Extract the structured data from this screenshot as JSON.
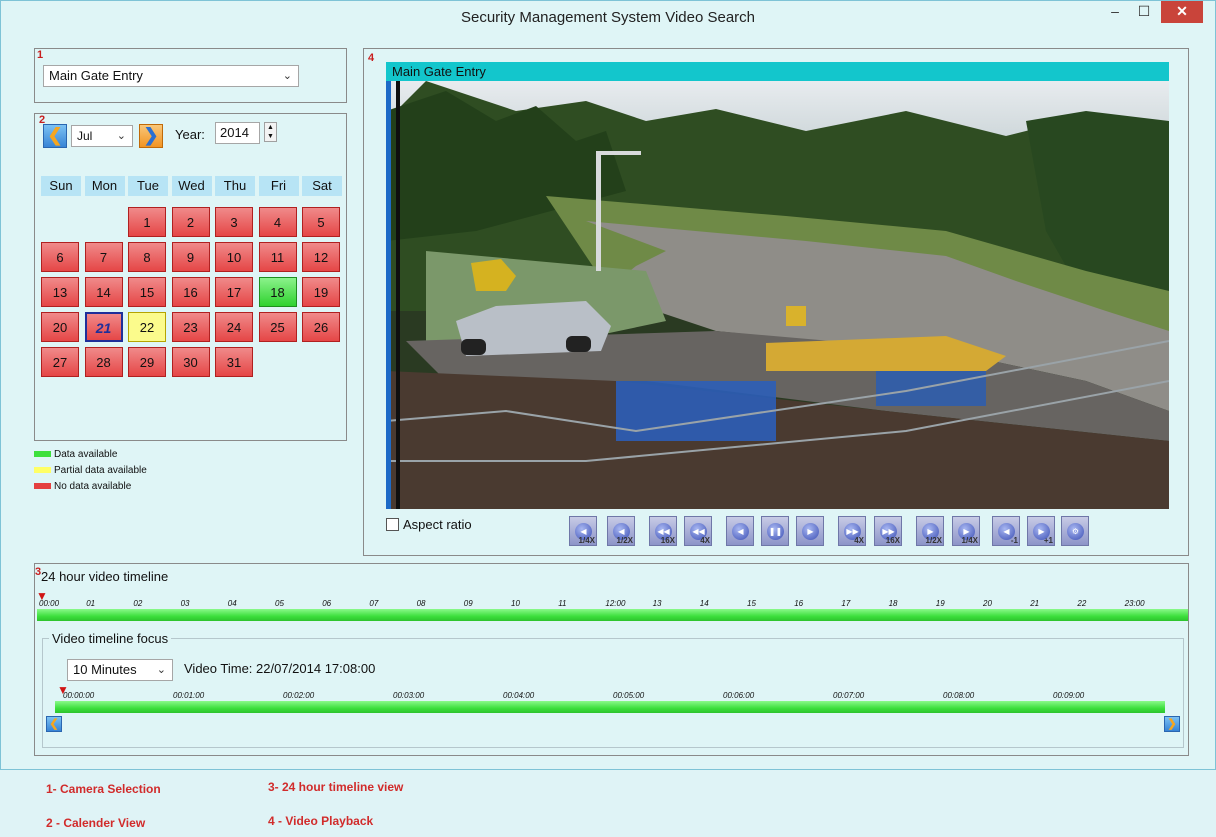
{
  "window": {
    "title": "Security Management System Video Search"
  },
  "camera": {
    "selected": "Main Gate Entry"
  },
  "panels": {
    "p1": "1",
    "p2": "2",
    "p3": "3",
    "p4": "4"
  },
  "calendar": {
    "month": "Jul",
    "year_label": "Year:",
    "year": "2014",
    "weekdays": [
      "Sun",
      "Mon",
      "Tue",
      "Wed",
      "Thu",
      "Fri",
      "Sat"
    ],
    "first_weekday_index": 2,
    "days_in_month": 31,
    "selected_day": 21,
    "green_days": [
      18
    ],
    "yellow_days": [
      22
    ]
  },
  "legend": {
    "available": "Data available",
    "partial": "Partial data available",
    "none": "No data available",
    "colors": {
      "available": "#3de03d",
      "partial": "#ffff66",
      "none": "#e44040"
    }
  },
  "video": {
    "camera_title": "Main Gate Entry",
    "aspect_label": "Aspect ratio"
  },
  "controls": [
    "1/4X",
    "1/2X",
    "16X",
    "4X",
    "",
    "",
    "",
    "4X",
    "16X",
    "1/2X",
    "1/4X",
    "-1",
    "+1",
    ""
  ],
  "timeline": {
    "title": "24 hour video timeline",
    "hours": [
      "00:00",
      "01",
      "02",
      "03",
      "04",
      "05",
      "06",
      "07",
      "08",
      "09",
      "10",
      "11",
      "12:00",
      "13",
      "14",
      "15",
      "16",
      "17",
      "18",
      "19",
      "20",
      "21",
      "22",
      "23:00"
    ],
    "focus_title": "Video timeline focus",
    "duration": "10 Minutes",
    "video_time": "Video Time: 22/07/2014 17:08:00",
    "minutes": [
      "00:00:00",
      "00:01:00",
      "00:02:00",
      "00:03:00",
      "00:04:00",
      "00:05:00",
      "00:06:00",
      "00:07:00",
      "00:08:00",
      "00:09:00"
    ]
  },
  "captions": {
    "c1": "1- Camera Selection",
    "c2": "2 - Calender View",
    "c3": "3- 24 hour timeline view",
    "c4": "4 - Video Playback"
  }
}
